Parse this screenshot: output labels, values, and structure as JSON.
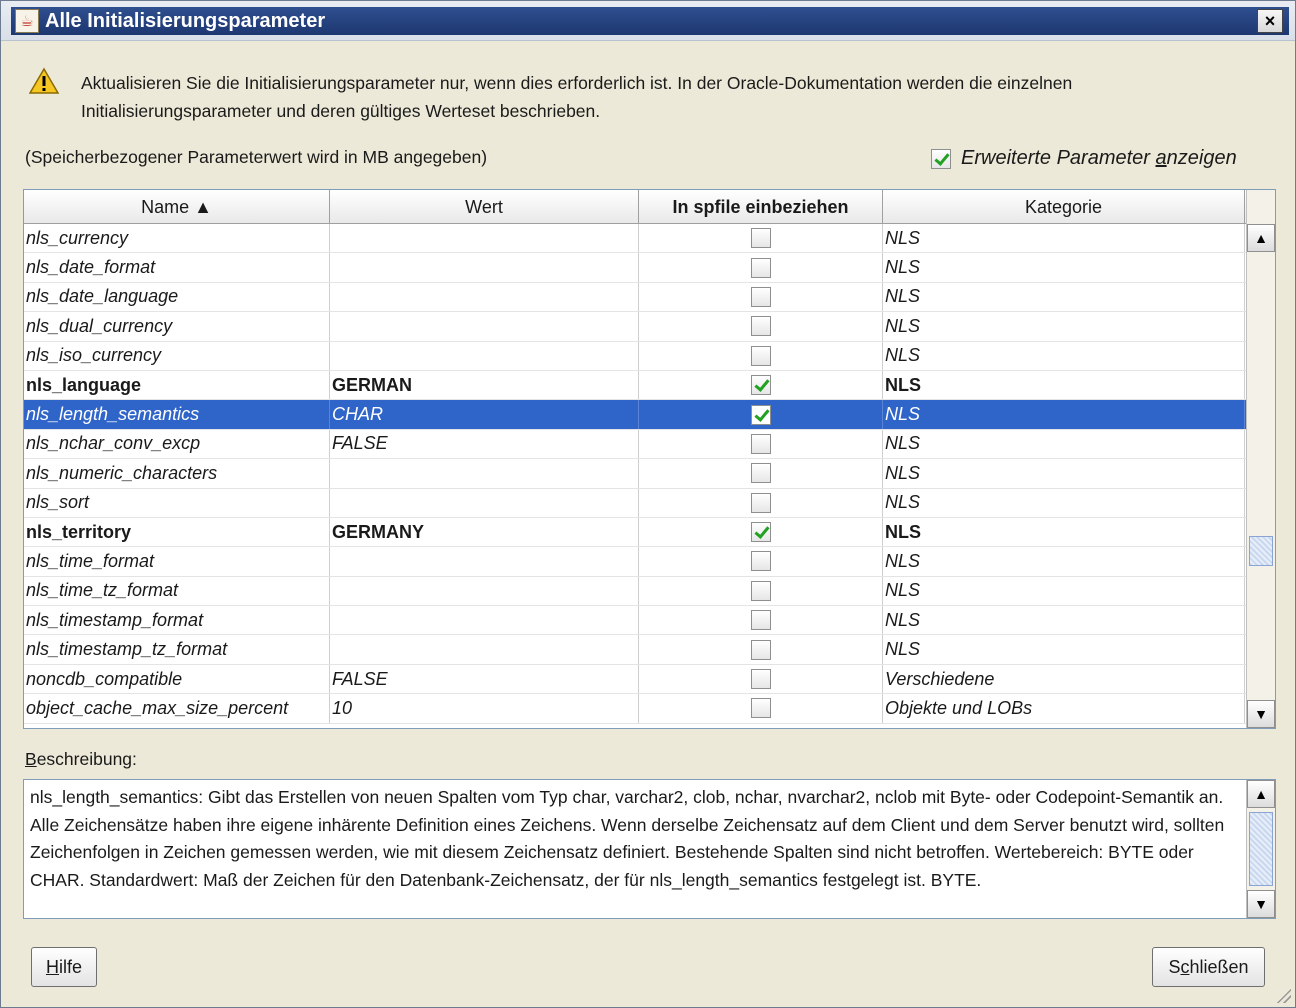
{
  "window": {
    "title": "Alle Initialisierungsparameter",
    "close_glyph": "×"
  },
  "warning": {
    "text": "Aktualisieren Sie die Initialisierungsparameter nur, wenn dies erforderlich ist. In der Oracle-Dokumentation werden die einzelnen Initialisierungsparameter und deren gültiges Werteset beschrieben."
  },
  "memory_note": "(Speicherbezogener Parameterwert wird in MB angegeben)",
  "advanced_checkbox": {
    "label_before": "Erweiterte Parameter ",
    "label_mnemonic": "a",
    "label_after": "nzeigen",
    "checked": true
  },
  "table": {
    "columns": [
      {
        "label": "Name ▲"
      },
      {
        "label": "Wert"
      },
      {
        "label": "In spfile einbeziehen"
      },
      {
        "label": "Kategorie"
      }
    ],
    "rows": [
      {
        "name": "nls_currency",
        "value": "",
        "include": false,
        "category": "NLS",
        "bold": false,
        "selected": false
      },
      {
        "name": "nls_date_format",
        "value": "",
        "include": false,
        "category": "NLS",
        "bold": false,
        "selected": false
      },
      {
        "name": "nls_date_language",
        "value": "",
        "include": false,
        "category": "NLS",
        "bold": false,
        "selected": false
      },
      {
        "name": "nls_dual_currency",
        "value": "",
        "include": false,
        "category": "NLS",
        "bold": false,
        "selected": false
      },
      {
        "name": "nls_iso_currency",
        "value": "",
        "include": false,
        "category": "NLS",
        "bold": false,
        "selected": false
      },
      {
        "name": "nls_language",
        "value": "GERMAN",
        "include": true,
        "category": "NLS",
        "bold": true,
        "selected": false
      },
      {
        "name": "nls_length_semantics",
        "value": "CHAR",
        "include": true,
        "category": "NLS",
        "bold": false,
        "selected": true
      },
      {
        "name": "nls_nchar_conv_excp",
        "value": "FALSE",
        "include": false,
        "category": "NLS",
        "bold": false,
        "selected": false
      },
      {
        "name": "nls_numeric_characters",
        "value": "",
        "include": false,
        "category": "NLS",
        "bold": false,
        "selected": false
      },
      {
        "name": "nls_sort",
        "value": "",
        "include": false,
        "category": "NLS",
        "bold": false,
        "selected": false
      },
      {
        "name": "nls_territory",
        "value": "GERMANY",
        "include": true,
        "category": "NLS",
        "bold": true,
        "selected": false
      },
      {
        "name": "nls_time_format",
        "value": "",
        "include": false,
        "category": "NLS",
        "bold": false,
        "selected": false
      },
      {
        "name": "nls_time_tz_format",
        "value": "",
        "include": false,
        "category": "NLS",
        "bold": false,
        "selected": false
      },
      {
        "name": "nls_timestamp_format",
        "value": "",
        "include": false,
        "category": "NLS",
        "bold": false,
        "selected": false
      },
      {
        "name": "nls_timestamp_tz_format",
        "value": "",
        "include": false,
        "category": "NLS",
        "bold": false,
        "selected": false
      },
      {
        "name": "noncdb_compatible",
        "value": "FALSE",
        "include": false,
        "category": "Verschiedene",
        "bold": false,
        "selected": false
      },
      {
        "name": "object_cache_max_size_percent",
        "value": "10",
        "include": false,
        "category": "Objekte und LOBs",
        "bold": false,
        "selected": false
      }
    ]
  },
  "description": {
    "label": "Beschreibung:",
    "text": "nls_length_semantics: Gibt das Erstellen von neuen Spalten vom Typ char, varchar2, clob, nchar, nvarchar2, nclob mit Byte- oder Codepoint-Semantik an. Alle Zeichensätze haben ihre eigene inhärente Definition eines Zeichens. Wenn derselbe Zeichensatz auf dem Client und dem Server benutzt wird, sollten Zeichenfolgen in Zeichen gemessen werden, wie mit diesem Zeichensatz definiert. Bestehende Spalten sind nicht betroffen. Wertebereich: BYTE oder CHAR. Standardwert: Maß der Zeichen für den Datenbank-Zeichensatz, der für nls_length_semantics festgelegt ist. BYTE."
  },
  "buttons": {
    "help": "Hilfe",
    "close": "Schließen"
  },
  "colors": {
    "selection": "#2f64c8",
    "titlebar": "#1d3770",
    "check_green": "#21a121"
  }
}
